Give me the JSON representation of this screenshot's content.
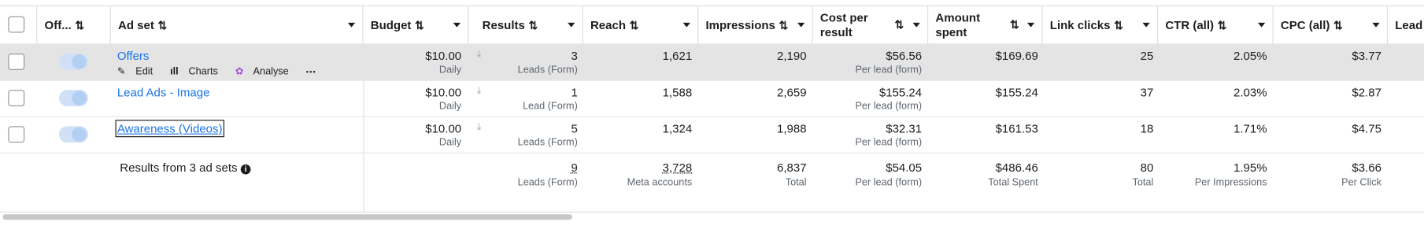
{
  "headers": {
    "off": "Off...",
    "ad_set": "Ad set",
    "budget": "Budget",
    "results": "Results",
    "reach": "Reach",
    "impressions": "Impressions",
    "cost_per_result": "Cost per result",
    "amount_spent": "Amount spent",
    "link_clicks": "Link clicks",
    "ctr": "CTR (all)",
    "cpc": "CPC (all)",
    "leads_partial": "Lead"
  },
  "sort_glyph": "⇅",
  "row_actions": {
    "edit": "Edit",
    "charts": "Charts",
    "analyse": "Analyse",
    "more": "•••"
  },
  "rows": [
    {
      "name": "Offers",
      "budget": "$10.00",
      "budget_type": "Daily",
      "results": "3",
      "results_type": "Leads (Form)",
      "reach": "1,621",
      "impressions": "2,190",
      "cost": "$56.56",
      "cost_type": "Per lead (form)",
      "spent": "$169.69",
      "clicks": "25",
      "ctr": "2.05%",
      "cpc": "$3.77",
      "toggle_on": true
    },
    {
      "name": "Lead Ads - Image",
      "budget": "$10.00",
      "budget_type": "Daily",
      "results": "1",
      "results_type": "Lead (Form)",
      "reach": "1,588",
      "impressions": "2,659",
      "cost": "$155.24",
      "cost_type": "Per lead (form)",
      "spent": "$155.24",
      "clicks": "37",
      "ctr": "2.03%",
      "cpc": "$2.87",
      "toggle_on": true
    },
    {
      "name": "Awareness (Videos)",
      "budget": "$10.00",
      "budget_type": "Daily",
      "results": "5",
      "results_type": "Leads (Form)",
      "reach": "1,324",
      "impressions": "1,988",
      "cost": "$32.31",
      "cost_type": "Per lead (form)",
      "spent": "$161.53",
      "clicks": "18",
      "ctr": "1.71%",
      "cpc": "$4.75",
      "toggle_on": true
    }
  ],
  "totals": {
    "label": "Results from 3 ad sets",
    "results": "9",
    "results_type": "Leads (Form)",
    "reach": "3,728",
    "reach_type": "Meta accounts",
    "impressions": "6,837",
    "impressions_type": "Total",
    "cost": "$54.05",
    "cost_type": "Per lead (form)",
    "spent": "$486.46",
    "spent_type": "Total Spent",
    "clicks": "80",
    "clicks_type": "Total",
    "ctr": "1.95%",
    "ctr_type": "Per Impressions",
    "cpc": "$3.66",
    "cpc_type": "Per Click"
  }
}
